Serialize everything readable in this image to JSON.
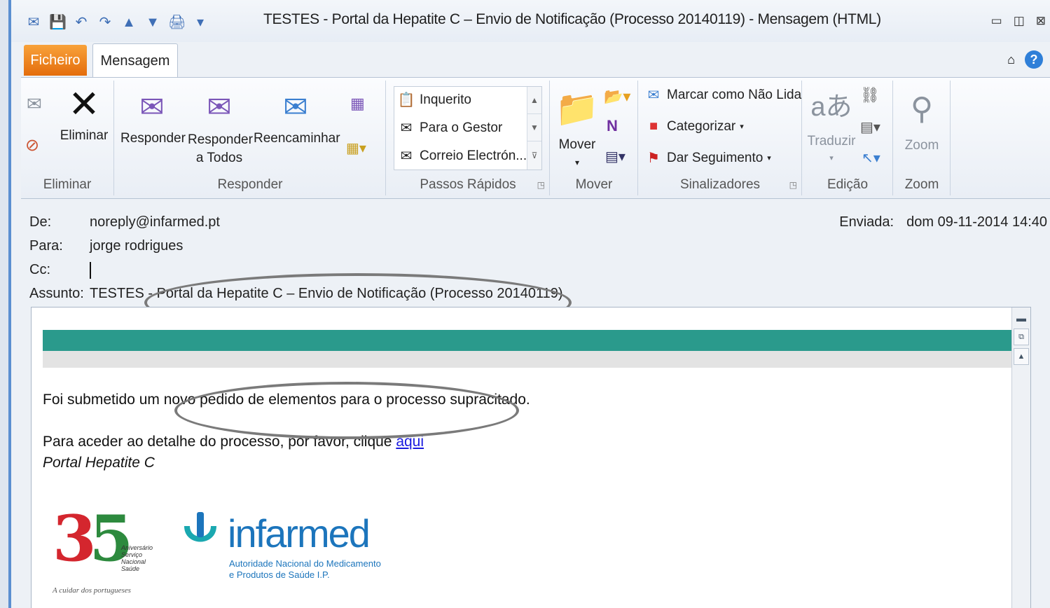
{
  "window": {
    "title": "TESTES - Portal da Hepatite C – Envio de Notificação (Processo 20140119)  -  Mensagem (HTML)",
    "controls": [
      "▭",
      "◫",
      "⊠"
    ]
  },
  "qat": [
    "✉",
    "💾",
    "↶",
    "↷",
    "▲",
    "▼",
    "🖨",
    "▾"
  ],
  "tabs": {
    "file": "Ficheiro",
    "message": "Mensagem"
  },
  "ribbon": {
    "groups": {
      "delete": {
        "label": "Eliminar",
        "eliminar": "Eliminar"
      },
      "respond": {
        "label": "Responder",
        "reply": "Responder",
        "reply_all_1": "Responder",
        "reply_all_2": "a Todos",
        "forward": "Reencaminhar"
      },
      "quick_steps": {
        "label": "Passos Rápidos",
        "items": [
          "Inquerito",
          "Para o Gestor",
          "Correio Electrón..."
        ]
      },
      "move": {
        "label": "Mover",
        "move": "Mover"
      },
      "tags": {
        "label": "Sinalizadores",
        "unread": "Marcar como Não Lida",
        "categorize": "Categorizar",
        "followup": "Dar Seguimento"
      },
      "editing": {
        "label": "Edição",
        "translate": "Traduzir"
      },
      "zoom": {
        "label": "Zoom",
        "zoom": "Zoom"
      }
    }
  },
  "header": {
    "from_label": "De:",
    "from": "noreply@infarmed.pt",
    "to_label": "Para:",
    "to": "jorge rodrigues",
    "cc_label": "Cc:",
    "subject_label": "Assunto:",
    "subject": "TESTES - Portal da Hepatite C – Envio de Notificação (Processo 20140119)",
    "sent_label": "Enviada:",
    "sent": "dom 09-11-2014 14:40"
  },
  "body": {
    "line1": "Foi submetido um novo pedido de elementos para o processo supracitado.",
    "line2": "Para aceder ao detalhe do processo, por favor, clique ",
    "link": "aqui",
    "signature": "Portal Hepatite C",
    "teal_color": "#2a9a8c"
  },
  "logos": {
    "sns": {
      "number_a": "3",
      "number_b": "5",
      "small": "Aniversário\nServiço\nNacional\nSaúde",
      "tagline": "A cuidar dos portugueses"
    },
    "infarmed": {
      "name": "infarmed",
      "sub1": "Autoridade Nacional do Medicamento",
      "sub2": "e Produtos de Saúde I.P."
    }
  }
}
